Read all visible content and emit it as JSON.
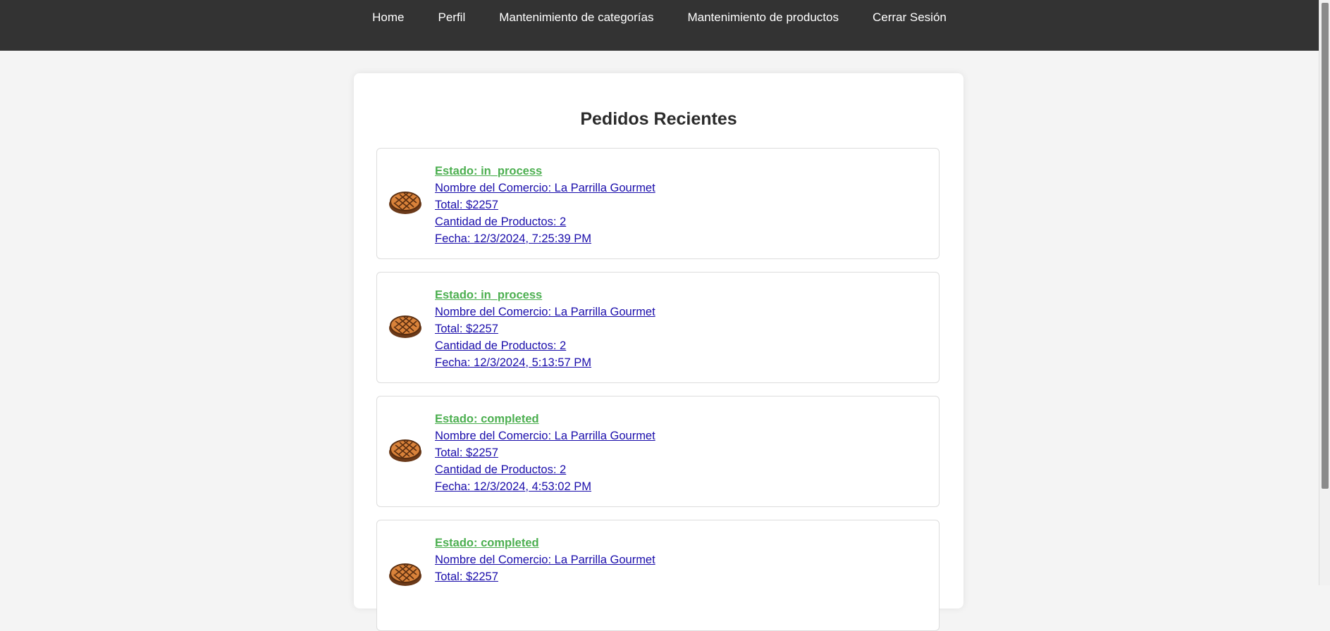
{
  "nav": {
    "items": [
      {
        "label": "Home"
      },
      {
        "label": "Perfil"
      },
      {
        "label": "Mantenimiento de categorías"
      },
      {
        "label": "Mantenimiento de productos"
      },
      {
        "label": "Cerrar Sesión"
      }
    ]
  },
  "main": {
    "title": "Pedidos Recientes",
    "orders": [
      {
        "status": "Estado: in_process",
        "store": "Nombre del Comercio: La Parrilla Gourmet",
        "total": "Total: $2257",
        "quantity": "Cantidad de Productos: 2",
        "date": "Fecha: 12/3/2024, 7:25:39 PM",
        "icon": "steak-icon"
      },
      {
        "status": "Estado: in_process",
        "store": "Nombre del Comercio: La Parrilla Gourmet",
        "total": "Total: $2257",
        "quantity": "Cantidad de Productos: 2",
        "date": "Fecha: 12/3/2024, 5:13:57 PM",
        "icon": "steak-icon"
      },
      {
        "status": "Estado: completed",
        "store": "Nombre del Comercio: La Parrilla Gourmet",
        "total": "Total: $2257",
        "quantity": "Cantidad de Productos: 2",
        "date": "Fecha: 12/3/2024, 4:53:02 PM",
        "icon": "steak-icon"
      },
      {
        "status": "Estado: completed",
        "store": "Nombre del Comercio: La Parrilla Gourmet",
        "total": "Total: $2257",
        "quantity": "",
        "date": "",
        "icon": "steak-icon"
      }
    ]
  },
  "colors": {
    "navbar": "#333333",
    "status": "#4caf50",
    "link": "#1a0dab",
    "background": "#f4f4f4"
  }
}
